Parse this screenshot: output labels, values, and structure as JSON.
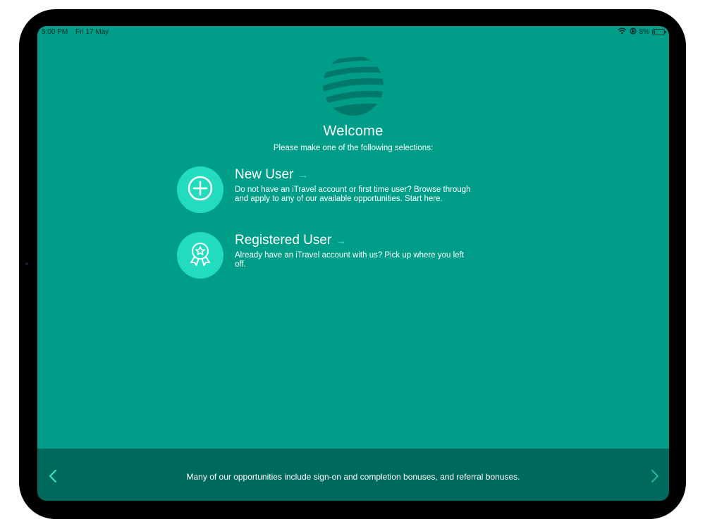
{
  "status_bar": {
    "time": "5:00 PM",
    "date": "Fri 17 May",
    "battery_percent": "8%",
    "battery_level": 0.08,
    "icons": [
      "wifi-icon",
      "orientation-lock-icon",
      "battery-charging-icon"
    ]
  },
  "welcome": {
    "title": "Welcome",
    "subtitle": "Please make one of the following selections:"
  },
  "options": [
    {
      "title": "New User",
      "arrow": "→",
      "description": "Do not have an iTravel account or first time user? Browse through and apply to any of our available opportunities. Start here.",
      "icon": "plus-circle-icon"
    },
    {
      "title": "Registered User",
      "arrow": "→",
      "description": "Already have an iTravel account with us? Pick up where you left off.",
      "icon": "award-badge-icon"
    }
  ],
  "footer": {
    "message": "Many of our opportunities include sign-on and completion bonuses, and referral bonuses.",
    "prev_icon": "chevron-left-icon",
    "next_icon": "chevron-right-icon"
  },
  "colors": {
    "background": "#009e88",
    "accent": "#23dcc0",
    "footer": "#00695e",
    "logo": "#00796b"
  }
}
